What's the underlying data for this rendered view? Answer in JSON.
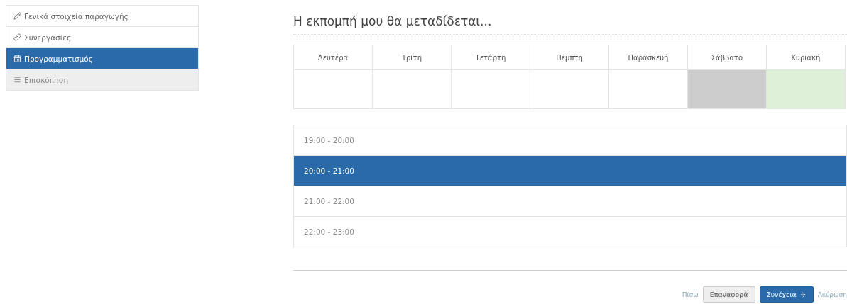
{
  "sidebar": {
    "items": [
      {
        "label": "Γενικά στοιχεία παραγωγής",
        "kind": "pencil",
        "selected": false,
        "disabled": false
      },
      {
        "label": "Συνεργασίες",
        "kind": "link",
        "selected": false,
        "disabled": false
      },
      {
        "label": "Προγραμματισμός",
        "kind": "calendar",
        "selected": true,
        "disabled": false
      },
      {
        "label": "Επισκόπηση",
        "kind": "list",
        "selected": false,
        "disabled": true
      }
    ]
  },
  "heading": "Η εκπομπή μου θα μεταδίδεται...",
  "days": [
    {
      "label": "Δευτέρα",
      "color": "#ffffff"
    },
    {
      "label": "Τρίτη",
      "color": "#ffffff"
    },
    {
      "label": "Τετάρτη",
      "color": "#ffffff"
    },
    {
      "label": "Πέμπτη",
      "color": "#ffffff"
    },
    {
      "label": "Παρασκευή",
      "color": "#ffffff"
    },
    {
      "label": "Σάββατο",
      "color": "#cccccc"
    },
    {
      "label": "Κυριακή",
      "color": "#dff0d8"
    }
  ],
  "time_slots": [
    {
      "label": "19:00 - 20:00",
      "selected": false
    },
    {
      "label": "20:00 - 21:00",
      "selected": true
    },
    {
      "label": "21:00 - 22:00",
      "selected": false
    },
    {
      "label": "22:00 - 23:00",
      "selected": false
    }
  ],
  "footer": {
    "back": "Πίσω",
    "reset": "Επαναφορά",
    "next": "Συνέχεια",
    "cancel": "Ακύρωση"
  }
}
